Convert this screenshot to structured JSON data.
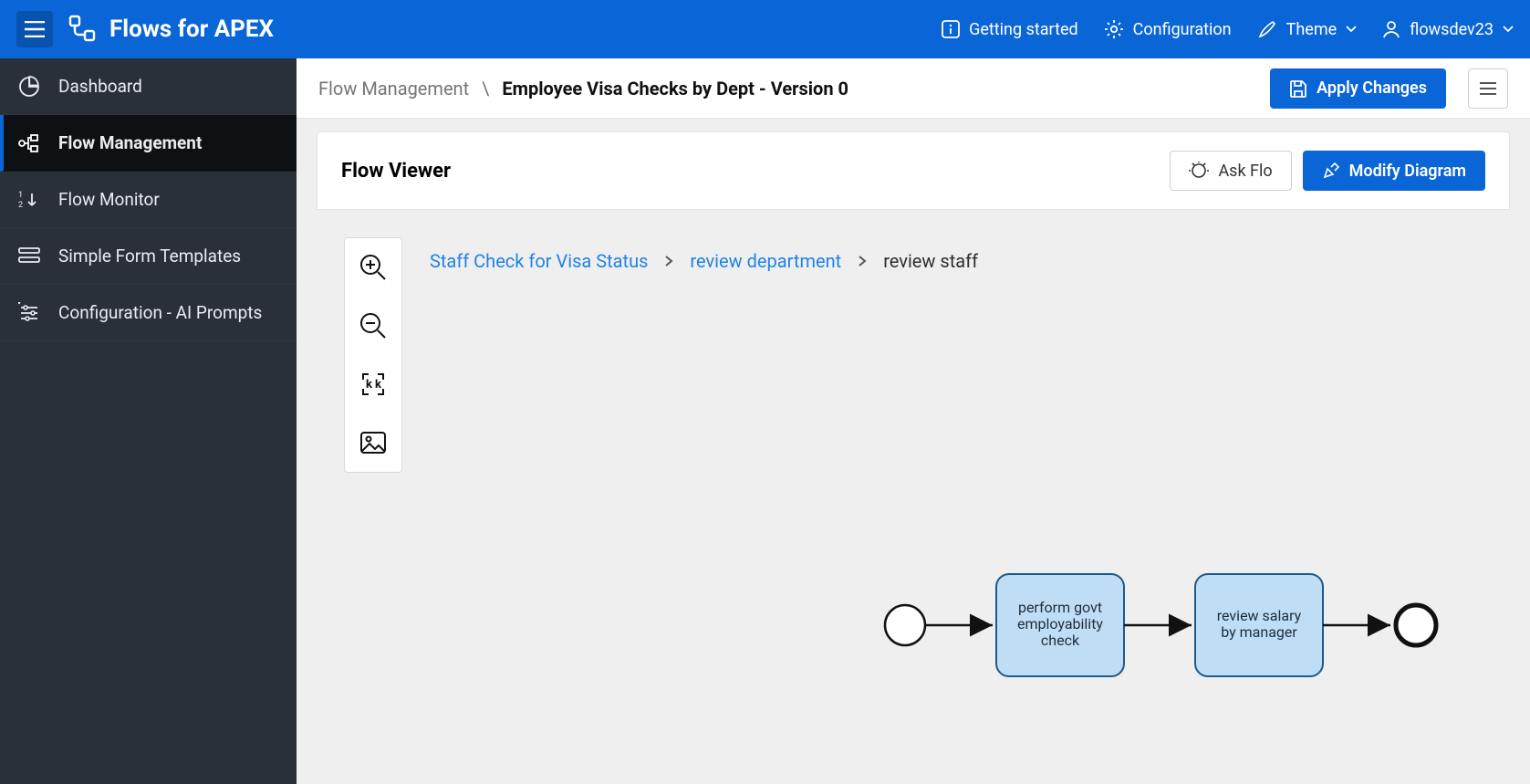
{
  "header": {
    "app_title": "Flows for APEX",
    "getting_started": "Getting started",
    "configuration": "Configuration",
    "theme": "Theme",
    "user_name": "flowsdev23"
  },
  "sidebar": {
    "items": [
      {
        "label": "Dashboard",
        "active": false
      },
      {
        "label": "Flow Management",
        "active": true
      },
      {
        "label": "Flow Monitor",
        "active": false
      },
      {
        "label": "Simple Form Templates",
        "active": false
      },
      {
        "label": "Configuration - AI Prompts",
        "active": false
      }
    ]
  },
  "breadcrumb": {
    "parent": "Flow Management",
    "sep": "\\",
    "title": "Employee Visa Checks by Dept - Version 0",
    "apply": "Apply Changes"
  },
  "panel": {
    "title": "Flow Viewer",
    "ask_flo": "Ask Flo",
    "modify": "Modify Diagram"
  },
  "canvas": {
    "crumbs": {
      "a": "Staff Check for Visa Status",
      "b": "review  department",
      "c": "review staff"
    },
    "tasks": {
      "t1_line1": "perform govt",
      "t1_line2": "employability",
      "t1_line3": "check",
      "t2_line1": "review salary",
      "t2_line2": "by manager"
    }
  }
}
